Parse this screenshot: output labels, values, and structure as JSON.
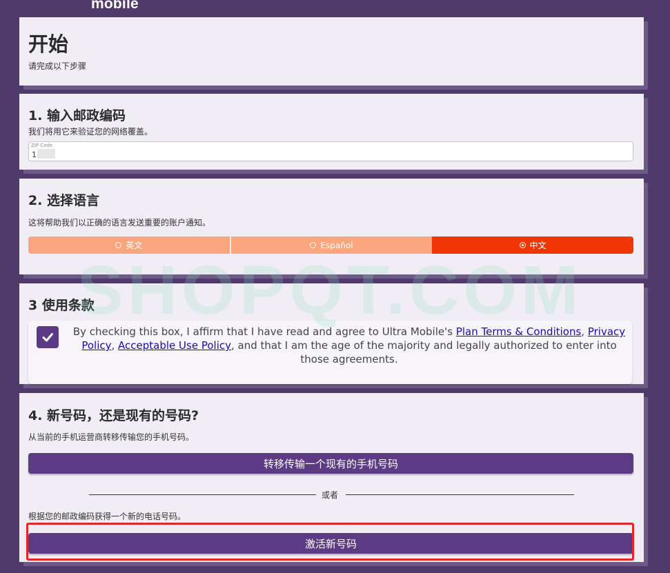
{
  "brand": "mobile",
  "intro": {
    "title": "开始",
    "subtitle": "请完成以下步骤"
  },
  "step1": {
    "title": "1. 输入邮政编码",
    "desc": "我们将用它来验证您的网络覆盖。",
    "zip_label": "ZIP Code",
    "zip_value": "1"
  },
  "step2": {
    "title": "2. 选择语言",
    "desc": "这将帮助我们以正确的语言发送重要的账户通知。",
    "options": [
      {
        "label": "英文",
        "selected": false
      },
      {
        "label": "Español",
        "selected": false
      },
      {
        "label": "中文",
        "selected": true
      }
    ]
  },
  "step3": {
    "title": "3 使用条款",
    "checked": true,
    "text_before": "By checking this box, I affirm that I have read and agree to Ultra Mobile's ",
    "link_plan": "Plan Terms & Conditions",
    "sep1": ", ",
    "link_privacy": "Privacy Policy",
    "sep2": ", ",
    "link_aup": "Acceptable Use Policy",
    "text_after": ", and that I am the age of the majority and legally authorized to enter into those agreements."
  },
  "step4": {
    "title": "4. 新号码，还是现有的号码?",
    "desc": "从当前的手机运营商转移传输您的手机号码。",
    "transfer_button": "转移传输一个现有的手机号码",
    "or": "或者",
    "new_desc": "根据您的邮政编码获得一个新的电话号码。",
    "activate_button": "激活新号码"
  },
  "watermark": "SHOPQT.COM",
  "colors": {
    "background": "#4f3a6b",
    "card": "#f1edf5",
    "accent_purple": "#5d3a84",
    "lang_selected": "#f03604",
    "lang_unselected": "#f9a57d",
    "highlight": "#e6252a"
  }
}
